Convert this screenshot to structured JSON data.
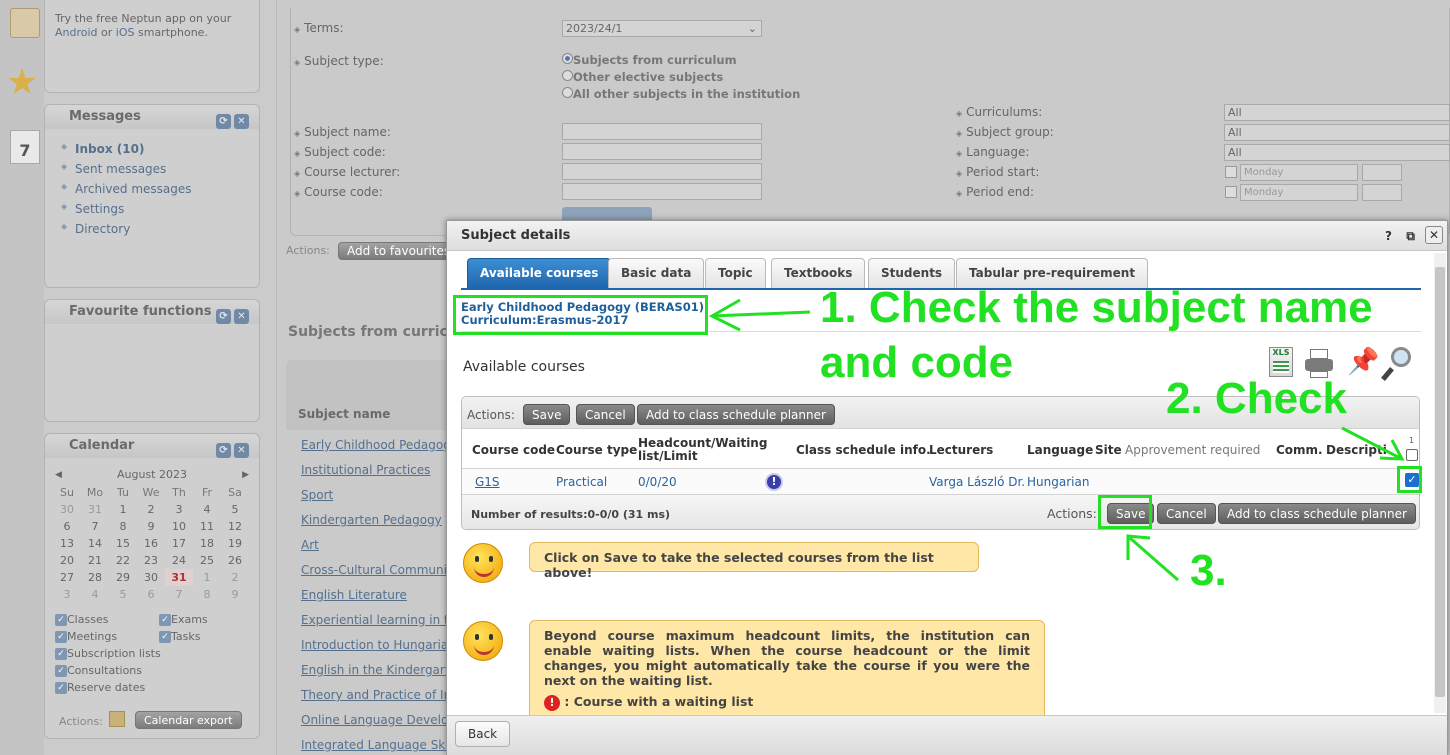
{
  "app_promo": {
    "text": "Try the free Neptun app on your",
    "android": "Android",
    "or": "or",
    "ios": "iOS",
    "tail": "smartphone."
  },
  "messages_panel": {
    "title": "Messages",
    "items": [
      "Inbox (10)",
      "Sent messages",
      "Archived messages",
      "Settings",
      "Directory"
    ]
  },
  "favourites_panel": {
    "title": "Favourite functions"
  },
  "calendar_panel": {
    "title": "Calendar",
    "month": "August 2023",
    "weekdays": [
      "Su",
      "Mo",
      "Tu",
      "We",
      "Th",
      "Fr",
      "Sa"
    ],
    "weeks": [
      [
        "30",
        "31",
        "1",
        "2",
        "3",
        "4",
        "5"
      ],
      [
        "6",
        "7",
        "8",
        "9",
        "10",
        "11",
        "12"
      ],
      [
        "13",
        "14",
        "15",
        "16",
        "17",
        "18",
        "19"
      ],
      [
        "20",
        "21",
        "22",
        "23",
        "24",
        "25",
        "26"
      ],
      [
        "27",
        "28",
        "29",
        "30",
        "31",
        "1",
        "2"
      ],
      [
        "3",
        "4",
        "5",
        "6",
        "7",
        "8",
        "9"
      ]
    ],
    "filters": [
      "Classes",
      "Exams",
      "Meetings",
      "Tasks",
      "Subscription lists",
      "Consultations",
      "Reserve dates"
    ],
    "actions_label": "Actions:",
    "export_button": "Calendar export"
  },
  "search_form": {
    "terms_label": "Terms:",
    "terms_value": "2023/24/1",
    "subject_type_label": "Subject type:",
    "subject_type_options": [
      "Subjects from curriculum",
      "Other elective subjects",
      "All other subjects in the institution"
    ],
    "subject_name_label": "Subject name:",
    "subject_code_label": "Subject code:",
    "course_lecturer_label": "Course lecturer:",
    "course_code_label": "Course code:",
    "curriculums_label": "Curriculums:",
    "curriculums_value": "All",
    "subject_group_label": "Subject group:",
    "subject_group_value": "All",
    "language_label": "Language:",
    "language_value": "All",
    "period_start_label": "Period start:",
    "period_end_label": "Period end:",
    "day_value": "Monday",
    "actions_label": "Actions:",
    "add_favourites": "Add to favourites"
  },
  "subjects_list": {
    "heading": "Subjects from curricul",
    "column": "Subject name",
    "items": [
      "Early Childhood Pedagogy",
      "Institutional Practices",
      "Sport",
      "Kindergarten Pedagogy",
      "Art",
      "Cross-Cultural Communica",
      "English Literature",
      "Experiential learning in th",
      "Introduction to Hungarian",
      "English in the Kindergarte",
      "Theory and Practice of Inn",
      "Online Language Develop",
      "Integrated Language Skill"
    ]
  },
  "dialog": {
    "title": "Subject details",
    "help": "?",
    "tabs": [
      "Available courses",
      "Basic data",
      "Topic",
      "Textbooks",
      "Students",
      "Tabular pre-requirement"
    ],
    "subject_line1": "Early Childhood Pedagogy (BERAS01)",
    "subject_line2": "Curriculum:Erasmus-2017",
    "section_title": "Available courses",
    "actions_label": "Actions:",
    "save": "Save",
    "cancel": "Cancel",
    "add_planner": "Add to class schedule planner",
    "columns": [
      "Course code",
      "Course type",
      "Headcount/Waiting list/Limit",
      "Class schedule info.",
      "Lecturers",
      "Language",
      "Site",
      "Approvement required",
      "Comm.",
      "Descripti"
    ],
    "select_all_count": "1",
    "row": {
      "code": "G1S",
      "type": "Practical",
      "headcount": "0/0/20",
      "lecturer": "Varga László Dr.",
      "language": "Hungarian"
    },
    "results": "Number of results:0-0/0 (31 ms)",
    "tip1": "Click on Save to take the selected courses from the list above!",
    "tip2": "Beyond course maximum headcount limits, the institution can enable waiting lists. When the course headcount or the limit changes, you might automatically take the course if you were the next on the waiting list.",
    "tip2_legend": ": Course with a waiting list",
    "back": "Back"
  },
  "annotations": {
    "step1_line1": "1. Check the subject name",
    "step1_line2": "and code",
    "step2": "2. Check",
    "step3": "3."
  },
  "colors": {
    "accent_tab": "#1f66ad",
    "annotation_green": "#22e022",
    "tip_bg": "#ffe7a8"
  }
}
